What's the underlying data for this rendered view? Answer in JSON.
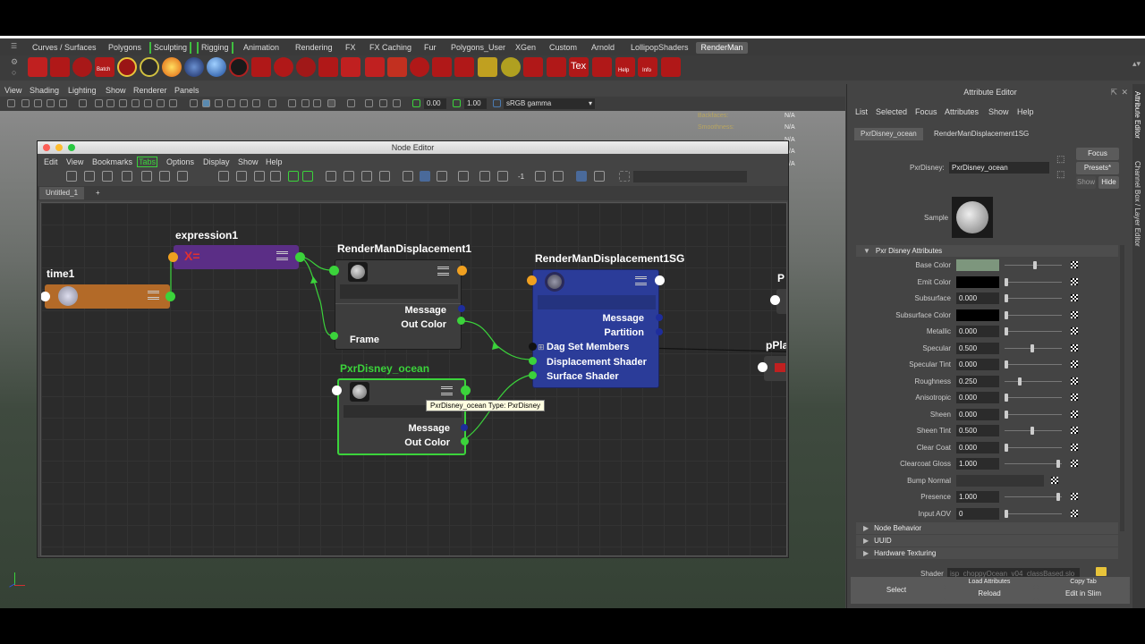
{
  "shelf": {
    "tabs": [
      "Curves / Surfaces",
      "Polygons",
      "Sculpting",
      "Rigging",
      "Animation",
      "Rendering",
      "FX",
      "FX Caching",
      "Fur",
      "Polygons_User",
      "XGen",
      "Custom",
      "Arnold",
      "LollipopShaders",
      "RenderMan"
    ],
    "active_tab": "RenderMan",
    "icon_labels": {
      "batch": "Batch",
      "tex": "Tex",
      "help": "Help",
      "info": "Info"
    }
  },
  "panel_menu": [
    "View",
    "Shading",
    "Lighting",
    "Show",
    "Renderer",
    "Panels"
  ],
  "panel_toolbar": {
    "value1": "0.00",
    "value2": "1.00",
    "color_space": "sRGB gamma"
  },
  "viewport_info": {
    "backfaces_label": "Backfaces:",
    "backfaces_value": "N/A",
    "smoothness_label": "Smoothness:",
    "smoothness_value": "N/A",
    "extra_values": [
      "N/A",
      "N/A",
      "N/A"
    ]
  },
  "node_editor": {
    "title": "Node Editor",
    "menu": [
      "Edit",
      "View",
      "Bookmarks",
      "Tabs",
      "Options",
      "Display",
      "Show",
      "Help"
    ],
    "tab": "Untitled_1",
    "add_tab": "+",
    "toolbar_value": "-1",
    "nodes": {
      "time1": {
        "title": "time1"
      },
      "expression1": {
        "title": "expression1",
        "symbol": "X="
      },
      "displacement": {
        "title": "RenderManDisplacement1",
        "attrs": [
          "Message",
          "Out Color",
          "Frame"
        ]
      },
      "sg": {
        "title": "RenderManDisplacement1SG",
        "attrs": [
          "Message",
          "Partition",
          "Dag Set Members",
          "Displacement Shader",
          "Surface Shader"
        ]
      },
      "pxr": {
        "title": "PxrDisney_ocean",
        "attrs": [
          "Message",
          "Out Color"
        ]
      },
      "partial1": {
        "title": "P"
      },
      "partial2": {
        "title": "pPla"
      }
    },
    "tooltip": "PxrDisney_ocean Type: PxrDisney"
  },
  "attribute_editor": {
    "title": "Attribute Editor",
    "menu": [
      "List",
      "Selected",
      "Focus",
      "Attributes",
      "Show",
      "Help"
    ],
    "tabs": [
      "PxrDisney_ocean",
      "RenderManDisplacement1SG"
    ],
    "active_tab": "PxrDisney_ocean",
    "node_label": "PxrDisney:",
    "node_name": "PxrDisney_ocean",
    "focus_button": "Focus",
    "presets_button": "Presets*",
    "show_button": "Show",
    "hide_button": "Hide",
    "sample_label": "Sample",
    "section_title": "Pxr Disney Attributes",
    "attributes": [
      {
        "label": "Base Color",
        "type": "color",
        "color": "#7d967d",
        "level": 0.55
      },
      {
        "label": "Emit Color",
        "type": "color",
        "color": "#000000",
        "level": 0.0
      },
      {
        "label": "Subsurface",
        "type": "value",
        "value": "0.000",
        "level": 0.0
      },
      {
        "label": "Subsurface Color",
        "type": "color",
        "color": "#000000",
        "level": 0.0
      },
      {
        "label": "Metallic",
        "type": "value",
        "value": "0.000",
        "level": 0.0
      },
      {
        "label": "Specular",
        "type": "value",
        "value": "0.500",
        "level": 0.5
      },
      {
        "label": "Specular Tint",
        "type": "value",
        "value": "0.000",
        "level": 0.0
      },
      {
        "label": "Roughness",
        "type": "value",
        "value": "0.250",
        "level": 0.25
      },
      {
        "label": "Anisotropic",
        "type": "value",
        "value": "0.000",
        "level": 0.0
      },
      {
        "label": "Sheen",
        "type": "value",
        "value": "0.000",
        "level": 0.0
      },
      {
        "label": "Sheen Tint",
        "type": "value",
        "value": "0.500",
        "level": 0.5
      },
      {
        "label": "Clear Coat",
        "type": "value",
        "value": "0.000",
        "level": 0.0
      },
      {
        "label": "Clearcoat Gloss",
        "type": "value",
        "value": "1.000",
        "level": 1.0
      },
      {
        "label": "Bump Normal",
        "type": "empty"
      },
      {
        "label": "Presence",
        "type": "value",
        "value": "1.000",
        "level": 1.0
      },
      {
        "label": "Input AOV",
        "type": "value",
        "value": "0",
        "level": 0.0
      }
    ],
    "collapsed_sections": [
      "Node Behavior",
      "UUID",
      "Hardware Texturing"
    ],
    "shader_label": "Shader",
    "shader_value": "isp_choppyOcean_v04_classBased.slo",
    "bottom_buttons": [
      "Select",
      "Load Attributes",
      "Copy Tab"
    ],
    "bottom_buttons2": [
      "Reload",
      "Edit in Slim"
    ]
  },
  "side_tabs": [
    "Attribute Editor",
    "Channel Box / Layer Editor"
  ],
  "colors": {
    "accent_green": "#3bd33b",
    "sg_node": "#2b3c99",
    "expression_node": "#5b2e86",
    "time_node": "#b36a28"
  }
}
